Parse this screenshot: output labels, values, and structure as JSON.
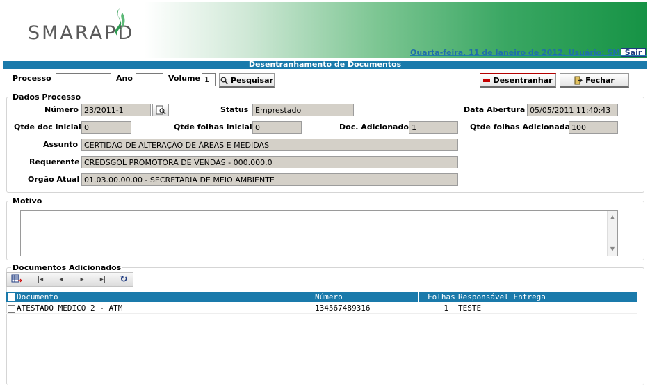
{
  "header": {
    "logo_text": "SMARAPD",
    "date_user": "Quarta-feira, 11 de Janeiro de 2012, Usuário: SMAR",
    "sair_label": "Sair"
  },
  "title": "Desentranhamento de Documentos",
  "search": {
    "processo_label": "Processo",
    "processo_value": "",
    "ano_label": "Ano",
    "ano_value": "",
    "volume_label": "Volume",
    "volume_value": "1",
    "pesquisar_label": "Pesquisar"
  },
  "actions": {
    "desentranhar_label": "Desentranhar",
    "fechar_label": "Fechar"
  },
  "dados_processo": {
    "legend": "Dados Processo",
    "numero_label": "Número",
    "numero_value": "23/2011-1",
    "status_label": "Status",
    "status_value": "Emprestado",
    "data_abertura_label": "Data Abertura",
    "data_abertura_value": "05/05/2011 11:40:43",
    "qtde_doc_inicial_label": "Qtde doc Inicial",
    "qtde_doc_inicial_value": "0",
    "qtde_folhas_inicial_label": "Qtde folhas Inicial",
    "qtde_folhas_inicial_value": "0",
    "doc_adicionado_label": "Doc. Adicionado",
    "doc_adicionado_value": "1",
    "qtde_folhas_adicionadas_label": "Qtde folhas Adicionadas",
    "qtde_folhas_adicionadas_value": "100",
    "assunto_label": "Assunto",
    "assunto_value": "CERTIDÃO DE ALTERAÇÃO DE ÁREAS E MEDIDAS",
    "requerente_label": "Requerente",
    "requerente_value": "CREDSGOL PROMOTORA DE VENDAS - 000.000.0",
    "orgao_atual_label": "Órgão Atual",
    "orgao_atual_value": "01.03.00.00.00 - SECRETARIA DE MEIO AMBIENTE"
  },
  "motivo": {
    "legend": "Motivo",
    "value": ""
  },
  "documentos": {
    "legend": "Documentos Adicionados",
    "columns": {
      "documento": "Documento",
      "numero": "Número",
      "folhas": "Folhas",
      "responsavel": "Responsável Entrega"
    },
    "rows": [
      {
        "documento": "ATESTADO MEDICO 2 - ATM",
        "numero": "134567489316",
        "folhas": "1",
        "responsavel": "TESTE"
      }
    ]
  },
  "colors": {
    "accent_blue": "#1a7aab",
    "brand_green": "#169345",
    "readonly_bg": "#d4d0c8"
  },
  "icons": [
    "leaf-logo-icon",
    "magnifier-icon",
    "minus-icon",
    "exit-door-icon",
    "lookup-icon",
    "export-icon",
    "first-page-icon",
    "prev-page-icon",
    "next-page-icon",
    "last-page-icon",
    "refresh-icon"
  ]
}
